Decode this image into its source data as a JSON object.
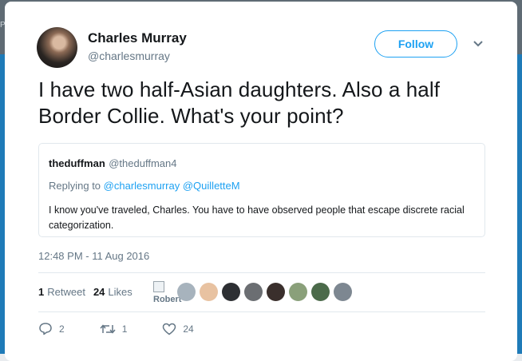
{
  "background": {
    "top_left_text": "Pr"
  },
  "author": {
    "name": "Charles Murray",
    "handle": "@charlesmurray",
    "follow_label": "Follow"
  },
  "tweet": {
    "text": "I have two half-Asian daughters. Also a half Border Collie. What's your point?",
    "timestamp": "12:48 PM - 11 Aug 2016"
  },
  "quoted": {
    "name": "theduffman",
    "handle": "@theduffman4",
    "replying_prefix": "Replying to",
    "replying_to": [
      "@charlesmurray",
      "@QuilletteM"
    ],
    "text": "I know you've traveled, Charles. You have to have observed people that escape discrete racial categorization."
  },
  "stats": {
    "retweets_count": "1",
    "retweets_label": "Retweet",
    "likes_count": "24",
    "likes_label": "Likes"
  },
  "likers": {
    "broken_avatar_alt": "Robert",
    "avatar_colors": [
      "#a7b3bd",
      "#e8c2a1",
      "#2d2f33",
      "#6b6e72",
      "#3a2f2c",
      "#8aa07a",
      "#4b6a4a",
      "#7d8791"
    ]
  },
  "actions": {
    "reply_count": "2",
    "retweet_count": "1",
    "like_count": "24"
  },
  "colors": {
    "accent": "#1da1f2",
    "muted": "#657786",
    "text": "#14171a"
  }
}
